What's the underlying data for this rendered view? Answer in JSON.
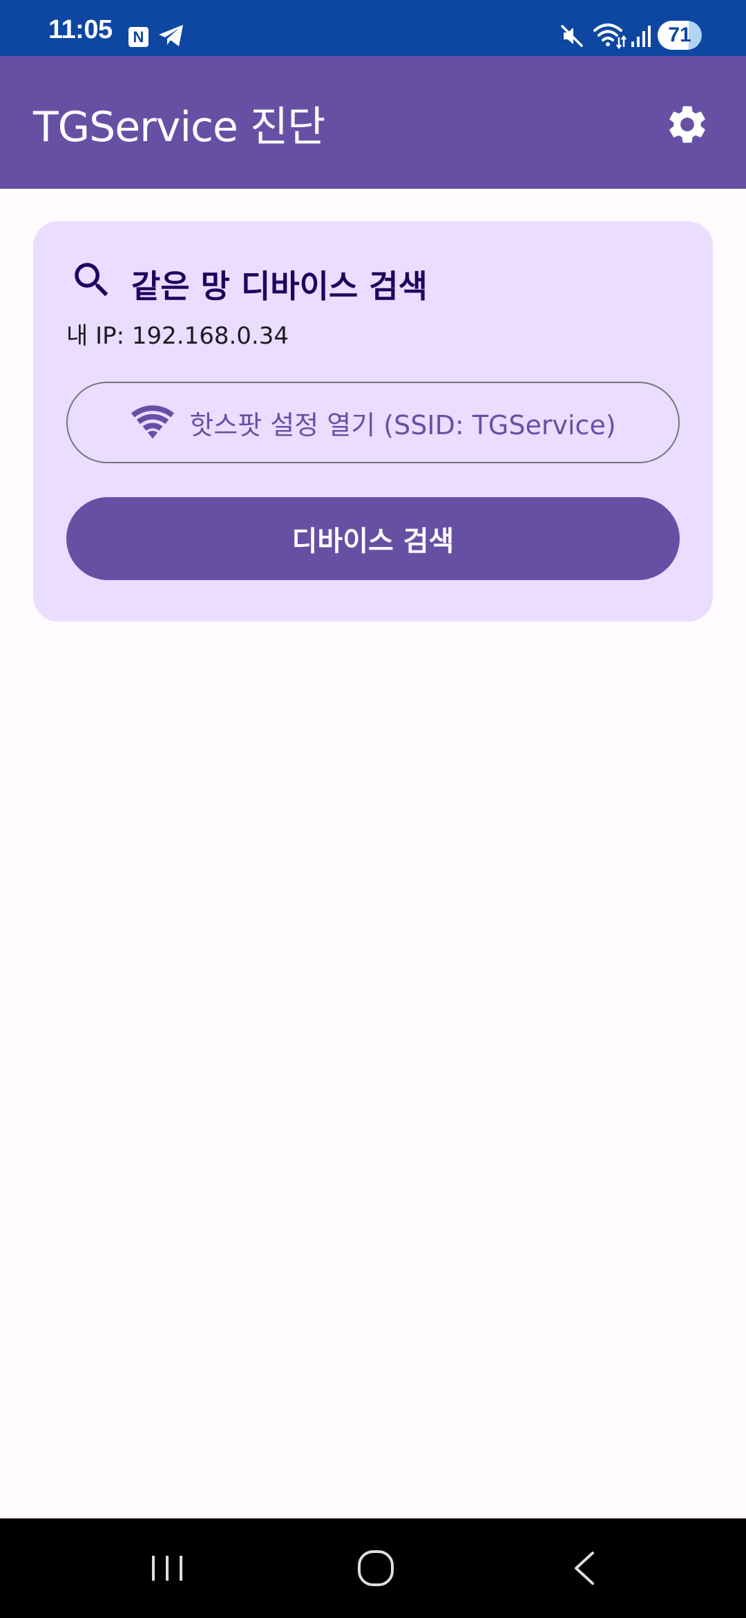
{
  "status_bar": {
    "time": "11:05",
    "notification_n": "N",
    "icons": [
      "n-notification-icon",
      "telegram-icon",
      "mute-icon",
      "wifi-icon",
      "signal-icon"
    ],
    "battery_level": "71",
    "battery_percent": 71
  },
  "app_bar": {
    "title": "TGService 진단",
    "settings_icon": "gear-icon"
  },
  "card": {
    "title": "같은 망 디바이스 검색",
    "ip_label": "내 IP: 192.168.0.34",
    "hotspot_button": "핫스팟 설정 열기 (SSID: TGService)",
    "scan_button": "디바이스 검색"
  },
  "colors": {
    "primary": "#6750a4",
    "status_bar": "#0d47a1",
    "card_bg": "#eaddff",
    "background": "#fffbfe"
  },
  "nav_bar": {
    "icons": [
      "recents-icon",
      "home-icon",
      "back-icon"
    ]
  }
}
